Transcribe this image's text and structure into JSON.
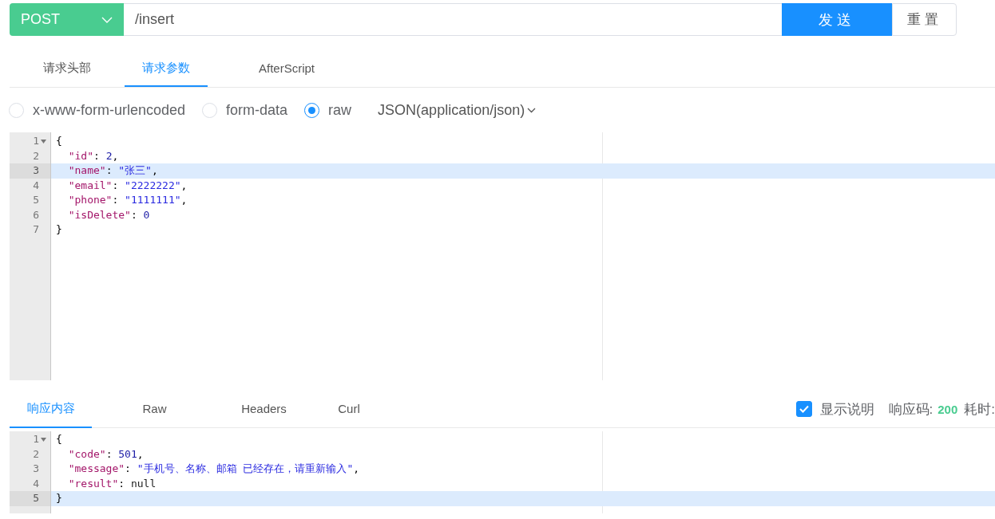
{
  "request": {
    "method": "POST",
    "url": "/insert",
    "send_label": "发送",
    "reset_label": "重置"
  },
  "request_tabs": [
    {
      "label": "请求头部",
      "selected": false
    },
    {
      "label": "请求参数",
      "selected": true
    },
    {
      "label": "AfterScript",
      "selected": false
    }
  ],
  "body_types": [
    {
      "label": "x-www-form-urlencoded",
      "selected": false
    },
    {
      "label": "form-data",
      "selected": false
    },
    {
      "label": "raw",
      "selected": true
    }
  ],
  "content_type": "JSON(application/json)",
  "request_body": {
    "lines": [
      {
        "number": "1",
        "foldable": true,
        "active": false,
        "tokens": [
          {
            "kind": "punct",
            "text": "{"
          }
        ]
      },
      {
        "number": "2",
        "foldable": false,
        "active": false,
        "tokens": [
          {
            "kind": "key",
            "text": "  \"id\""
          },
          {
            "kind": "punct",
            "text": ": "
          },
          {
            "kind": "number",
            "text": "2"
          },
          {
            "kind": "punct",
            "text": ","
          }
        ]
      },
      {
        "number": "3",
        "foldable": false,
        "active": true,
        "tokens": [
          {
            "kind": "key",
            "text": "  \"name\""
          },
          {
            "kind": "punct",
            "text": ": "
          },
          {
            "kind": "string",
            "text": "\"张三\""
          },
          {
            "kind": "punct",
            "text": ","
          }
        ]
      },
      {
        "number": "4",
        "foldable": false,
        "active": false,
        "tokens": [
          {
            "kind": "key",
            "text": "  \"email\""
          },
          {
            "kind": "punct",
            "text": ": "
          },
          {
            "kind": "string",
            "text": "\"2222222\""
          },
          {
            "kind": "punct",
            "text": ","
          }
        ]
      },
      {
        "number": "5",
        "foldable": false,
        "active": false,
        "tokens": [
          {
            "kind": "key",
            "text": "  \"phone\""
          },
          {
            "kind": "punct",
            "text": ": "
          },
          {
            "kind": "string",
            "text": "\"1111111\""
          },
          {
            "kind": "punct",
            "text": ","
          }
        ]
      },
      {
        "number": "6",
        "foldable": false,
        "active": false,
        "tokens": [
          {
            "kind": "key",
            "text": "  \"isDelete\""
          },
          {
            "kind": "punct",
            "text": ": "
          },
          {
            "kind": "number",
            "text": "0"
          }
        ]
      },
      {
        "number": "7",
        "foldable": false,
        "active": false,
        "tokens": [
          {
            "kind": "punct",
            "text": "}"
          }
        ]
      }
    ]
  },
  "response_tabs": [
    {
      "label": "响应内容",
      "selected": true
    },
    {
      "label": "Raw",
      "selected": false
    },
    {
      "label": "Headers",
      "selected": false
    },
    {
      "label": "Curl",
      "selected": false
    }
  ],
  "show_description": {
    "label": "显示说明",
    "checked": true
  },
  "status_code": {
    "label": "响应码:",
    "value": "200"
  },
  "elapsed": {
    "label": "耗时:"
  },
  "response_body": {
    "lines": [
      {
        "number": "1",
        "foldable": true,
        "active": false,
        "tokens": [
          {
            "kind": "punct",
            "text": "{"
          }
        ]
      },
      {
        "number": "2",
        "foldable": false,
        "active": false,
        "tokens": [
          {
            "kind": "key",
            "text": "  \"code\""
          },
          {
            "kind": "punct",
            "text": ": "
          },
          {
            "kind": "number",
            "text": "501"
          },
          {
            "kind": "punct",
            "text": ","
          }
        ]
      },
      {
        "number": "3",
        "foldable": false,
        "active": false,
        "tokens": [
          {
            "kind": "key",
            "text": "  \"message\""
          },
          {
            "kind": "punct",
            "text": ": "
          },
          {
            "kind": "string",
            "text": "\"手机号、名称、邮箱 已经存在，请重新输入\""
          },
          {
            "kind": "punct",
            "text": ","
          }
        ]
      },
      {
        "number": "4",
        "foldable": false,
        "active": false,
        "tokens": [
          {
            "kind": "key",
            "text": "  \"result\""
          },
          {
            "kind": "punct",
            "text": ": "
          },
          {
            "kind": "null",
            "text": "null"
          }
        ]
      },
      {
        "number": "5",
        "foldable": false,
        "active": true,
        "tokens": [
          {
            "kind": "punct",
            "text": "}"
          }
        ]
      }
    ]
  }
}
